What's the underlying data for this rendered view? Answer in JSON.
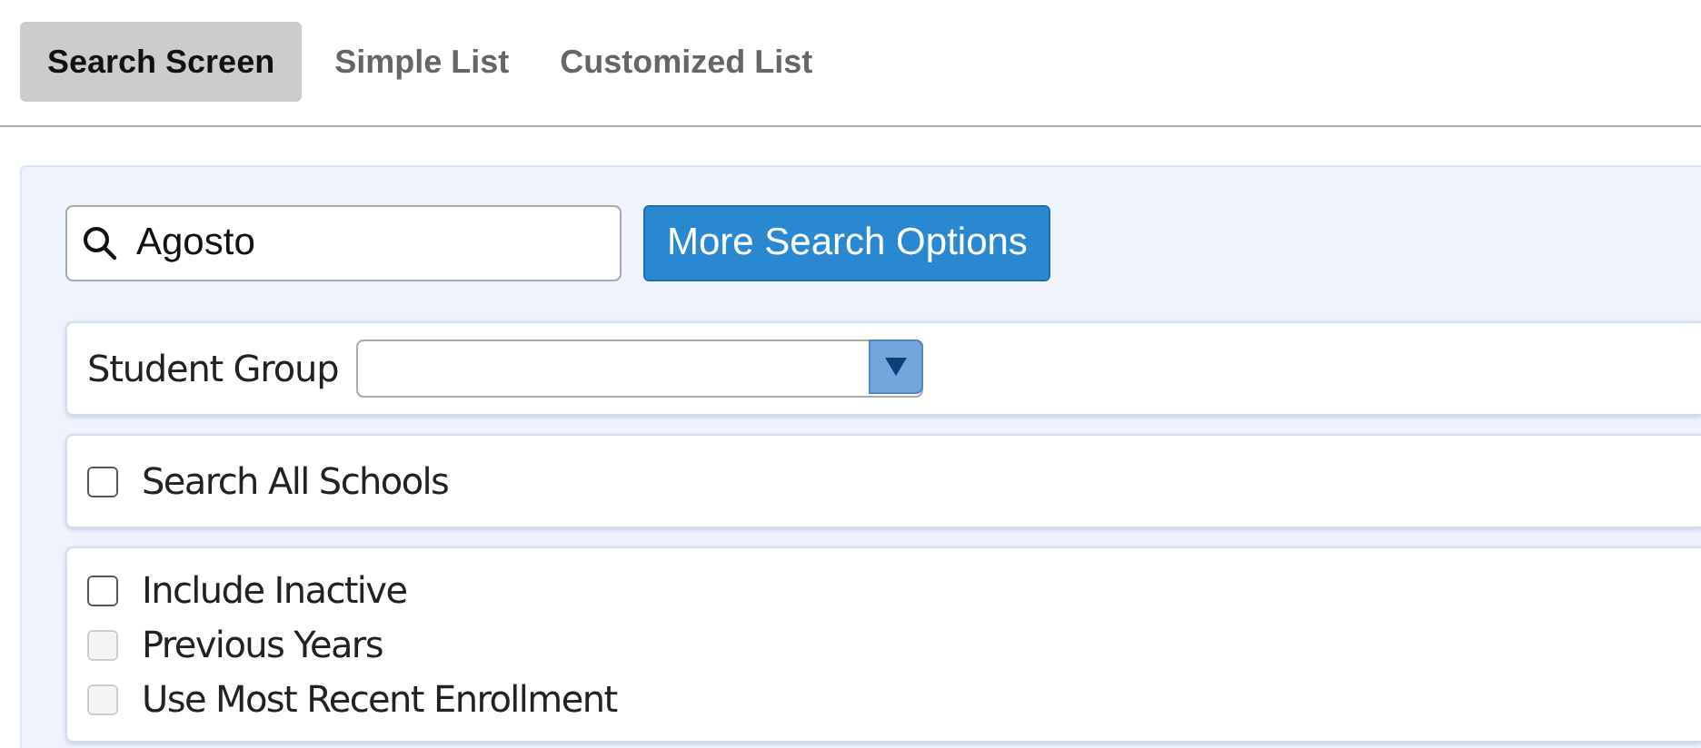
{
  "tabs": [
    {
      "label": "Search Screen",
      "selected": true
    },
    {
      "label": "Simple List",
      "selected": false
    },
    {
      "label": "Customized List",
      "selected": false
    }
  ],
  "search": {
    "value": "Agosto"
  },
  "more_button": "More Search Options",
  "student_group": {
    "label": "Student Group"
  },
  "search_all_schools": {
    "label": "Search All Schools",
    "checked": false,
    "disabled": false
  },
  "options": [
    {
      "label": "Include Inactive",
      "checked": false,
      "disabled": false
    },
    {
      "label": "Previous Years",
      "checked": false,
      "disabled": true
    },
    {
      "label": "Use Most Recent Enrollment",
      "checked": false,
      "disabled": true
    }
  ]
}
